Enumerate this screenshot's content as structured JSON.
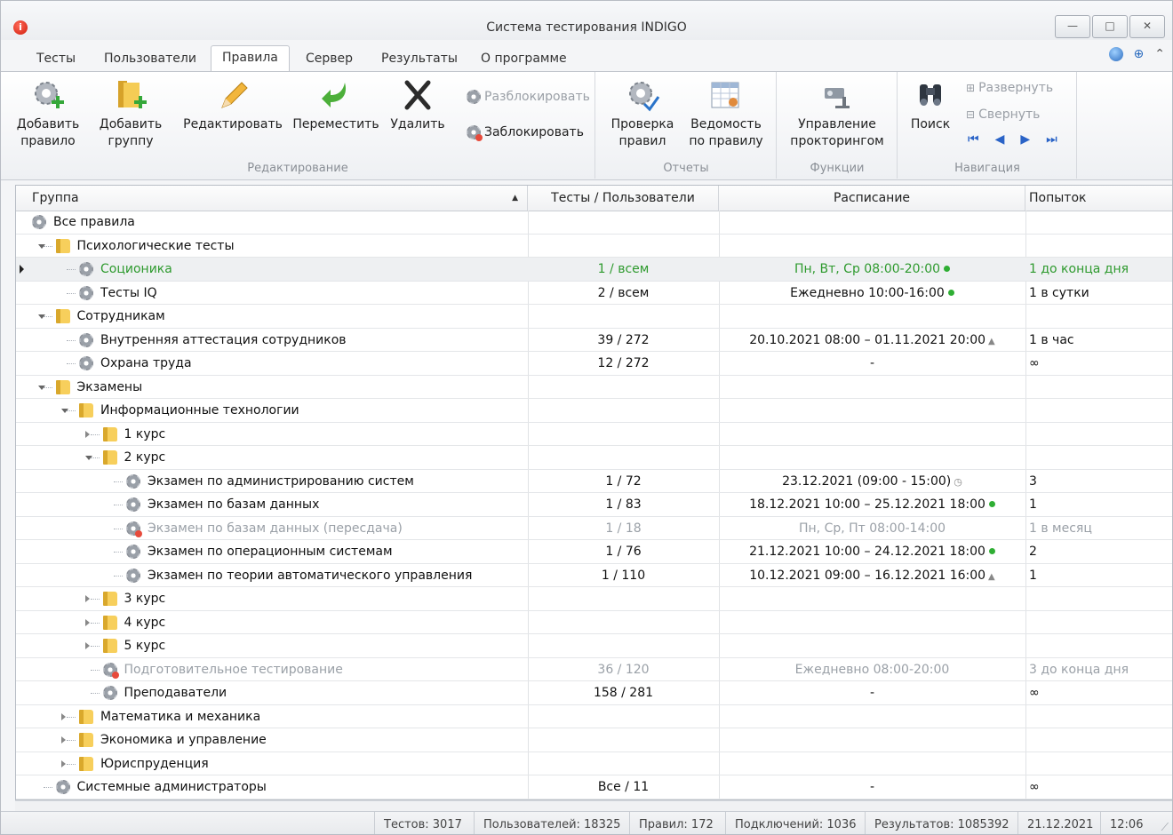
{
  "window": {
    "title": "Система тестирования INDIGO",
    "controls": {
      "minimize": "—",
      "maximize": "□",
      "close": "✕"
    }
  },
  "tabs": [
    "Тесты",
    "Пользователи",
    "Правила",
    "Сервер",
    "Результаты",
    "О программе"
  ],
  "active_tab": "Правила",
  "ribbon": {
    "editing": {
      "label": "Редактирование",
      "add_rule": [
        "Добавить",
        "правило"
      ],
      "add_group": [
        "Добавить",
        "группу"
      ],
      "edit": "Редактировать",
      "move": "Переместить",
      "delete": "Удалить",
      "unlock": "Разблокировать",
      "lock": "Заблокировать"
    },
    "reports": {
      "label": "Отчеты",
      "check": [
        "Проверка",
        "правил"
      ],
      "sheet": [
        "Ведомость",
        "по правилу"
      ]
    },
    "functions": {
      "label": "Функции",
      "proctoring": [
        "Управление",
        "прокторингом"
      ]
    },
    "navigation": {
      "label": "Навигация",
      "search": "Поиск",
      "expand": "Развернуть",
      "collapse": "Свернуть"
    }
  },
  "grid": {
    "columns": [
      "Группа",
      "Тесты / Пользователи",
      "Расписание",
      "Попыток"
    ],
    "rows": [
      {
        "name": "Все правила",
        "tests": "",
        "schedule": "",
        "attempts": ""
      },
      {
        "name": "Психологические тесты",
        "tests": "",
        "schedule": "",
        "attempts": ""
      },
      {
        "name": "Соционика",
        "tests": "1 / всем",
        "schedule": "Пн, Вт, Ср 08:00-20:00",
        "attempts": "1 до конца дня"
      },
      {
        "name": "Тесты IQ",
        "tests": "2 / всем",
        "schedule": "Ежедневно 10:00-16:00",
        "attempts": "1 в сутки"
      },
      {
        "name": "Сотрудникам",
        "tests": "",
        "schedule": "",
        "attempts": ""
      },
      {
        "name": "Внутренняя аттестация сотрудников",
        "tests": "39 / 272",
        "schedule": "20.10.2021 08:00 – 01.11.2021 20:00",
        "attempts": "1 в час"
      },
      {
        "name": "Охрана труда",
        "tests": "12 / 272",
        "schedule": "-",
        "attempts": "∞"
      },
      {
        "name": "Экзамены",
        "tests": "",
        "schedule": "",
        "attempts": ""
      },
      {
        "name": "Информационные технологии",
        "tests": "",
        "schedule": "",
        "attempts": ""
      },
      {
        "name": "1 курс",
        "tests": "",
        "schedule": "",
        "attempts": ""
      },
      {
        "name": "2 курс",
        "tests": "",
        "schedule": "",
        "attempts": ""
      },
      {
        "name": "Экзамен по администрированию систем",
        "tests": "1 / 72",
        "schedule": "23.12.2021 (09:00 - 15:00)",
        "attempts": "3"
      },
      {
        "name": "Экзамен по базам данных",
        "tests": "1 / 83",
        "schedule": "18.12.2021 10:00 – 25.12.2021 18:00",
        "attempts": "1"
      },
      {
        "name": "Экзамен по базам данных (пересдача)",
        "tests": "1 / 18",
        "schedule": "Пн, Ср, Пт 08:00-14:00",
        "attempts": "1 в месяц"
      },
      {
        "name": "Экзамен по операционным системам",
        "tests": "1 / 76",
        "schedule": "21.12.2021 10:00 – 24.12.2021 18:00",
        "attempts": "2"
      },
      {
        "name": "Экзамен по теории автоматического управления",
        "tests": "1 / 110",
        "schedule": "10.12.2021 09:00 – 16.12.2021 16:00",
        "attempts": "1"
      },
      {
        "name": "3 курс",
        "tests": "",
        "schedule": "",
        "attempts": ""
      },
      {
        "name": "4 курс",
        "tests": "",
        "schedule": "",
        "attempts": ""
      },
      {
        "name": "5 курс",
        "tests": "",
        "schedule": "",
        "attempts": ""
      },
      {
        "name": "Подготовительное тестирование",
        "tests": "36 / 120",
        "schedule": "Ежедневно 08:00-20:00",
        "attempts": "3 до конца дня"
      },
      {
        "name": "Преподаватели",
        "tests": "158 / 281",
        "schedule": "-",
        "attempts": "∞"
      },
      {
        "name": "Математика и механика",
        "tests": "",
        "schedule": "",
        "attempts": ""
      },
      {
        "name": "Экономика и управление",
        "tests": "",
        "schedule": "",
        "attempts": ""
      },
      {
        "name": "Юриспруденция",
        "tests": "",
        "schedule": "",
        "attempts": ""
      },
      {
        "name": "Системные администраторы",
        "tests": "Все / 11",
        "schedule": "-",
        "attempts": "∞"
      }
    ]
  },
  "status": {
    "tests": "Тестов: 3017",
    "users": "Пользователей: 18325",
    "rules": "Правил: 172",
    "connections": "Подключений: 1036",
    "results": "Результатов: 1085392",
    "date": "21.12.2021",
    "time": "12:06"
  }
}
